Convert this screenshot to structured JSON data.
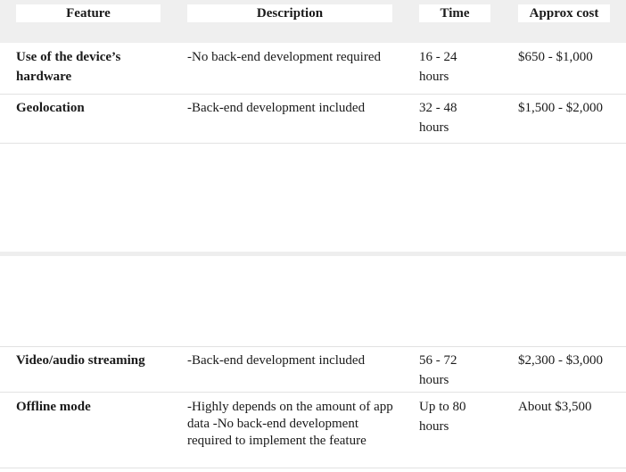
{
  "table": {
    "headers": {
      "feature": "Feature",
      "description": "Description",
      "time": "Time",
      "cost": "Approx cost"
    },
    "rows": [
      {
        "feature": "Use of the device’s hardware",
        "description": "-No back-end development required",
        "time": "16 - 24 hours",
        "cost": "$650 - $1,000"
      },
      {
        "feature": "Geolocation",
        "description": "-Back-end development included",
        "time": "32 - 48 hours",
        "cost": "$1,500 - $2,000"
      },
      {
        "feature": "Video/audio streaming",
        "description": "-Back-end development included",
        "time": "56 - 72 hours",
        "cost": "$2,300 - $3,000"
      },
      {
        "feature": "Offline mode",
        "description": "-Highly depends on the amount of app data -No back-end development required to implement the feature",
        "time": "Up to 80 hours",
        "cost": "About $3,500"
      }
    ]
  }
}
